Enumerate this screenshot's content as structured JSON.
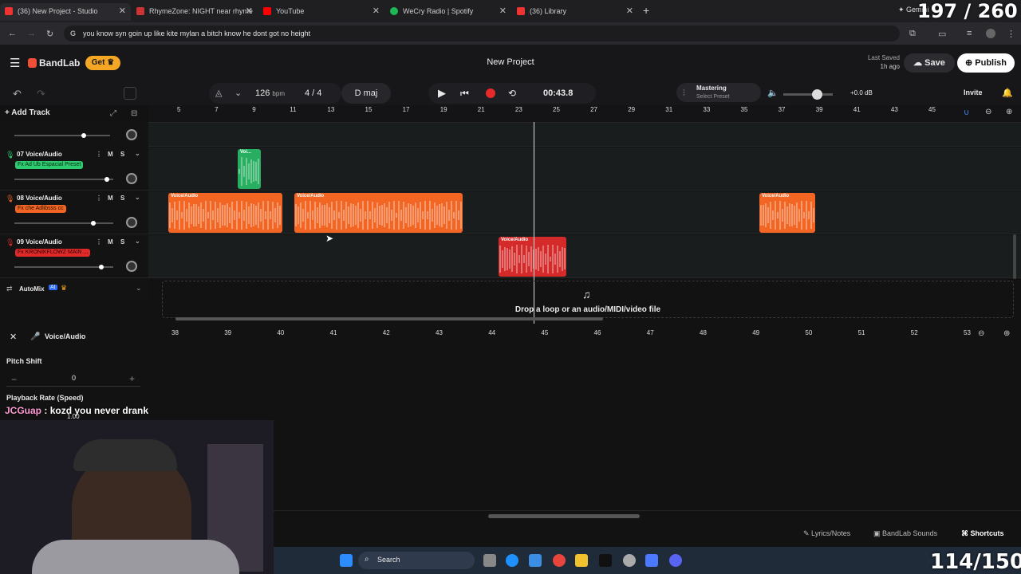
{
  "browser": {
    "tabs": [
      {
        "label": "(36) New Project - Studio",
        "active": true,
        "color": "#e33"
      },
      {
        "label": "RhymeZone: NIGHT near rhyme",
        "active": false,
        "color": "#c33"
      },
      {
        "label": "YouTube",
        "active": false,
        "color": "#f00"
      },
      {
        "label": "WeCry Radio | Spotify",
        "active": false,
        "color": "#1db954"
      },
      {
        "label": "(36) Library",
        "active": false,
        "color": "#e33"
      }
    ],
    "gemini_label": "Gemini",
    "url": "you know syn goin up like kite mylan a bitch know he dont got no height"
  },
  "header": {
    "brand": "BandLab",
    "get_label": "Get",
    "project_title": "New Project",
    "last_saved_label": "Last Saved",
    "last_saved_time": "1h ago",
    "save_label": "Save",
    "publish_label": "Publish"
  },
  "transport": {
    "bpm_value": "126",
    "bpm_unit": "bpm",
    "time_sig": "4 / 4",
    "key": "D maj",
    "time": "00:43.8",
    "mastering_label": "Mastering",
    "mastering_sub": "Select Preset",
    "master_db": "+0.0 dB",
    "invite_label": "Invite"
  },
  "tracks_panel": {
    "add_track_label": "Add Track",
    "automix_label": "AutoMix",
    "ai_badge": "AI"
  },
  "ruler_ticks": [
    "5",
    "7",
    "9",
    "11",
    "13",
    "15",
    "17",
    "19",
    "21",
    "23",
    "25",
    "27",
    "29",
    "31",
    "33",
    "35",
    "37",
    "39",
    "41",
    "43",
    "45"
  ],
  "tracks": [
    {
      "num": "07",
      "name": "Voice/Audio",
      "fx": "Fx Ad Ub Espacial Preset",
      "fx_color": "#2ecc71",
      "fx_text": "#0c2a14",
      "vol": 0.94,
      "clips": [
        {
          "label": "Voi...",
          "color": "#27ae60"
        }
      ]
    },
    {
      "num": "08",
      "name": "Voice/Audio",
      "fx": "Fx che Adlibsss cc",
      "fx_color": "#f26522",
      "fx_text": "#2a1003",
      "vol": 0.8,
      "clips": [
        {
          "label": "Voice/Audio",
          "color": "#f26522"
        },
        {
          "label": "Voice/Audio",
          "color": "#f26522"
        },
        {
          "label": "Voice/Audio",
          "color": "#f26522"
        }
      ]
    },
    {
      "num": "09",
      "name": "Voice/Audio",
      "fx": "Fx KRONIKFLOWZ MAIN ...",
      "fx_color": "#e02a2a",
      "fx_text": "#2a0404",
      "vol": 0.88,
      "clips": [
        {
          "label": "Voice/Audio",
          "color": "#d42a2a"
        }
      ]
    }
  ],
  "dropzone": {
    "text": "Drop a loop or an audio/MIDI/video file"
  },
  "editor": {
    "track_label": "Voice/Audio",
    "pitch_label": "Pitch Shift",
    "pitch_value": "0",
    "rate_label": "Playback Rate (Speed)",
    "rate_value": "1.00",
    "ruler_ticks": [
      "38",
      "39",
      "40",
      "41",
      "42",
      "43",
      "44",
      "45",
      "46",
      "47",
      "48",
      "49",
      "50",
      "51",
      "52",
      "53"
    ]
  },
  "footer": {
    "lyrics_label": "Lyrics/Notes",
    "sounds_label": "BandLab Sounds",
    "shortcuts_label": "Shortcuts"
  },
  "taskbar": {
    "search_label": "Search"
  },
  "overlays": {
    "chat_user": "JCGuap",
    "chat_message": ": kozd you never drank",
    "counter_top": "197 / 260",
    "counter_bottom": "114/150"
  }
}
